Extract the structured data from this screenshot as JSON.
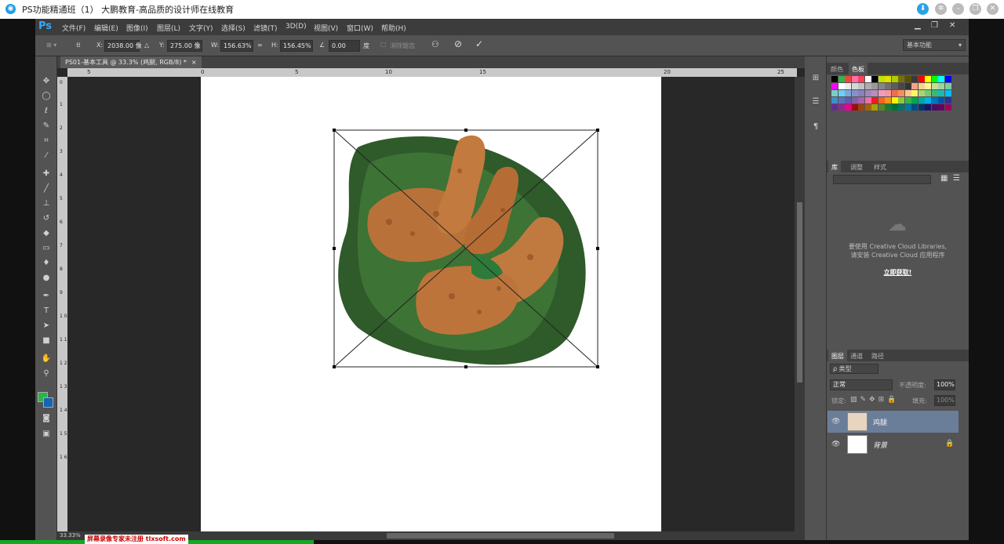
{
  "window": {
    "title": "PS功能精通班（1） 大鹏教育-高品质的设计师在线教育"
  },
  "menubar": {
    "logo": "Ps",
    "items": [
      "文件(F)",
      "编辑(E)",
      "图像(I)",
      "图层(L)",
      "文字(Y)",
      "选择(S)",
      "滤镜(T)",
      "3D(D)",
      "视图(V)",
      "窗口(W)",
      "帮助(H)"
    ]
  },
  "options": {
    "x_label": "X:",
    "x_value": "2038.00 像",
    "y_label": "Y:",
    "y_value": "275.00 像",
    "w_label": "W:",
    "w_value": "156.63%",
    "h_label": "H:",
    "h_value": "156.45%",
    "angle_value": "0.00",
    "angle_unit": "度",
    "antialias_label": "消除锯齿",
    "workspace": "基本功能"
  },
  "document": {
    "tab_label": "PS01-基本工具 @ 33.3% (鸡腿, RGB/8) *",
    "zoom": "33.33%",
    "ruler_h": [
      "5",
      "0",
      "5",
      "10",
      "15",
      "20",
      "25"
    ],
    "ruler_v": [
      "0",
      "1",
      "2",
      "3",
      "4",
      "5",
      "6",
      "7",
      "8",
      "9",
      "1 0",
      "1 1",
      "1 2",
      "1 3",
      "1 4",
      "1 5",
      "1 6"
    ]
  },
  "swatches_panel": {
    "tabs": [
      "颜色",
      "色板"
    ],
    "colors": [
      "#000000",
      "#34b34a",
      "#f0453a",
      "#ff6ea8",
      "#ff3f5b",
      "#ffffff",
      "#000000",
      "#c8e000",
      "#e4e000",
      "#a8d000",
      "#7a6e00",
      "#5a5000",
      "#3a3a3a",
      "#ff0000",
      "#ffff00",
      "#00ff00",
      "#00ffff",
      "#0000ff",
      "#ff00ff",
      "#ffffff",
      "#ebebeb",
      "#d6d6d6",
      "#c2c2c2",
      "#adadad",
      "#999999",
      "#858585",
      "#707070",
      "#5c5c5c",
      "#474747",
      "#333333",
      "#f7a08a",
      "#fbd18b",
      "#fff799",
      "#c4df9b",
      "#a3d39c",
      "#82ca9d",
      "#7accc8",
      "#6dcff6",
      "#7da7d9",
      "#8393ca",
      "#8781bd",
      "#a187be",
      "#bd8cbf",
      "#f49ac1",
      "#f5989d",
      "#f26c4f",
      "#f68e56",
      "#fdc689",
      "#fff568",
      "#acd373",
      "#7cc576",
      "#3bb878",
      "#1abbb4",
      "#00bff3",
      "#448ccb",
      "#5674b9",
      "#605ca8",
      "#855fa8",
      "#a864a8",
      "#f06eaa",
      "#ed1c24",
      "#f26522",
      "#f7941d",
      "#fff200",
      "#8dc73f",
      "#39b54a",
      "#00a651",
      "#00a99d",
      "#00aeef",
      "#0072bc",
      "#0054a6",
      "#2e3192",
      "#662d91",
      "#92278f",
      "#ec008c",
      "#9e0b0f",
      "#a0410d",
      "#a36209",
      "#aba000",
      "#598527",
      "#1a7b30",
      "#007236",
      "#00746b",
      "#0076a3",
      "#004b80",
      "#003471",
      "#1b1464",
      "#440e62",
      "#630460",
      "#9e005d"
    ]
  },
  "library_panel": {
    "tabs": [
      "库",
      "调整",
      "样式"
    ],
    "cc_line1": "要使用 Creative Cloud Libraries,",
    "cc_line2": "请安装 Creative Cloud 应用程序",
    "cc_link": "立即获取!"
  },
  "layers_panel": {
    "tabs": [
      "图层",
      "通道",
      "路径"
    ],
    "filter_kind": "ρ 类型",
    "blend_mode": "正常",
    "opacity_label": "不透明度:",
    "opacity_value": "100%",
    "lock_label": "锁定:",
    "fill_label": "填充:",
    "fill_value": "100%",
    "layers": [
      {
        "name": "鸡腿",
        "selected": true
      },
      {
        "name": "背景",
        "selected": false
      }
    ]
  },
  "watermark": "屏幕录像专家未注册 tlxsoft.com"
}
